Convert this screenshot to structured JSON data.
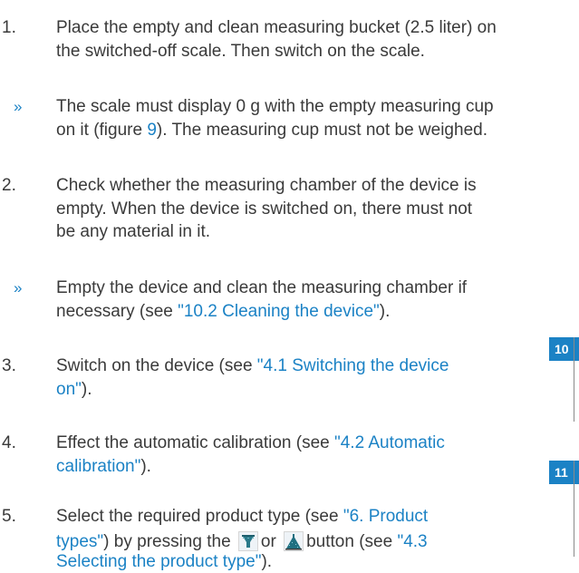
{
  "steps": [
    {
      "num": "1.",
      "lines": [
        "Place the empty and clean measuring bucket (2.5 liter) on",
        "the switched-off scale. Then switch on the scale."
      ]
    },
    {
      "num": "2.",
      "lines": [
        "Check whether the measuring chamber of the device is",
        "empty. When the device is switched on, there must not",
        "be any material in it."
      ]
    },
    {
      "num": "3.",
      "pre": "Switch on the device (see ",
      "link1": "\"4.1 Switching the device",
      "link2": "on\"",
      "post": ")."
    },
    {
      "num": "4.",
      "pre": "Effect the automatic calibration (see ",
      "link1": "\"4.2 Automatic",
      "link2": "calibration\"",
      "post": ")."
    },
    {
      "num": "5.",
      "pre": "Select the required product type (see ",
      "link1": "\"6. Product",
      "link2": "types\"",
      "mid1": ") by pressing the",
      "or": "or",
      "mid2": "button (see ",
      "link3": "\"4.3",
      "link4": "Selecting the product type\"",
      "post": ")."
    }
  ],
  "results": [
    {
      "arrow": "»",
      "line1": "The scale must display 0 g with the empty measuring cup",
      "line2_pre": "on it (figure ",
      "figure_ref": "9",
      "line2_post": "). The measuring cup must not be weighed."
    },
    {
      "arrow": "»",
      "line1": "Empty the device and clean the measuring chamber if",
      "line2_pre": "necessary (see ",
      "link": "\"10.2 Cleaning the device\"",
      "line2_post": ")."
    }
  ],
  "figures": [
    {
      "label": "10"
    },
    {
      "label": "11"
    }
  ],
  "colors": {
    "accent": "#1b82c5",
    "text": "#3a3a3a"
  },
  "icons": {
    "button_a": "funnel-product-icon",
    "button_b": "pile-product-icon"
  }
}
